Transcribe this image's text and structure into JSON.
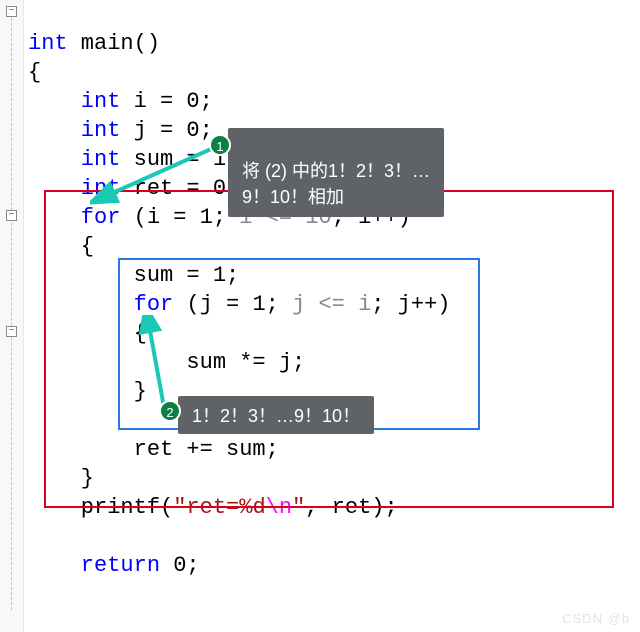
{
  "colors": {
    "keyword": "#0000ff",
    "string": "#a31515",
    "escape": "#ff00ff",
    "cond": "#888888",
    "red_box": "#d9001b",
    "blue_box": "#2b78e4",
    "callout_bg": "#5f6368",
    "badge_bg": "#0b8043",
    "arrow": "#19c9b5"
  },
  "fold_glyph": "−",
  "code": {
    "l1_ty": "int",
    "l1_fn": " main()",
    "l2": "{",
    "l3_ty": "    int",
    "l3_rest": " i = 0;",
    "l4_ty": "    int",
    "l4_rest": " j = 0;",
    "l5_ty": "    int",
    "l5_rest": " sum = 1;",
    "l6_ty": "    int",
    "l6_rest": " ret = 0;",
    "l7_kw": "    for",
    "l7_a": " (i = 1; ",
    "l7_cond": "i <= 10",
    "l7_b": "; i++)",
    "l8": "    {",
    "l9": "        sum = 1;",
    "l10_kw": "        for",
    "l10_a": " (j = 1; ",
    "l10_cond": "j <= i",
    "l10_b": "; j++)",
    "l11": "        {",
    "l12": "            sum *= j;",
    "l13": "        }",
    "l14": "",
    "l15": "        ret += sum;",
    "l16": "    }",
    "l17_a": "    printf(",
    "l17_s1": "\"ret=%d",
    "l17_esc": "\\n",
    "l17_s2": "\"",
    "l17_b": ", ret);",
    "l18": "",
    "l19_kw": "    return",
    "l19_rest": " 0;"
  },
  "callouts": {
    "c1_line1": "将 (2) 中的1！2！3！…",
    "c1_line2": "9！10！相加",
    "c2": "1！2！3！…9！10！"
  },
  "badges": {
    "b1": "1",
    "b2": "2"
  },
  "watermark": "CSDN @b   "
}
